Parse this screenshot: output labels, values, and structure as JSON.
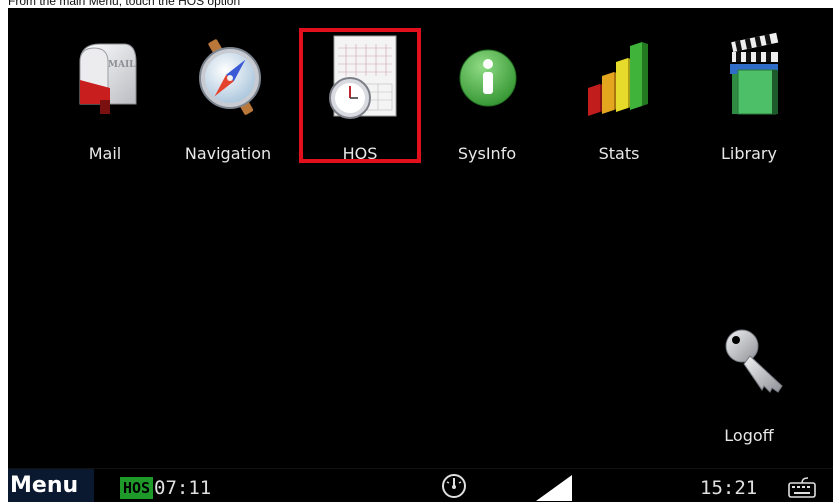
{
  "instruction": "From the main Menu, touch the HOS option",
  "apps": [
    {
      "id": "mail",
      "label": "Mail",
      "icon": "mailbox-icon"
    },
    {
      "id": "navigation",
      "label": "Navigation",
      "icon": "compass-icon"
    },
    {
      "id": "hos",
      "label": "HOS",
      "icon": "logbook-stopwatch-icon"
    },
    {
      "id": "sysinfo",
      "label": "SysInfo",
      "icon": "info-icon"
    },
    {
      "id": "stats",
      "label": "Stats",
      "icon": "bar-chart-icon"
    },
    {
      "id": "library",
      "label": "Library",
      "icon": "clapper-book-icon"
    }
  ],
  "logoff": {
    "label": "Logoff",
    "icon": "key-icon"
  },
  "mail_icon_text": "MAIL",
  "taskbar": {
    "menu_label": "Menu",
    "hos_badge": "HOS",
    "hos_time": "07:11",
    "clock": "15:21"
  },
  "colors": {
    "screen_bg": "#000000",
    "highlight": "#e2101c",
    "hos_badge": "#1f9a2a"
  }
}
